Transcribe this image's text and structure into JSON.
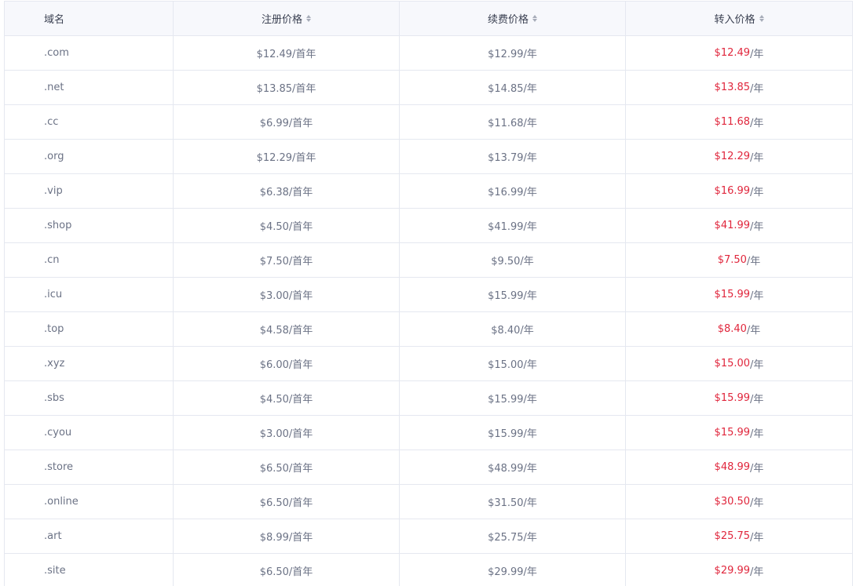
{
  "headers": {
    "domain": "域名",
    "register": "注册价格",
    "renew": "续费价格",
    "transfer": "转入价格"
  },
  "rows": [
    {
      "domain": ".com",
      "register": "$12.49/首年",
      "renew": "$12.99/年",
      "transfer_price": "$12.49",
      "transfer_unit": "/年"
    },
    {
      "domain": ".net",
      "register": "$13.85/首年",
      "renew": "$14.85/年",
      "transfer_price": "$13.85",
      "transfer_unit": "/年"
    },
    {
      "domain": ".cc",
      "register": "$6.99/首年",
      "renew": "$11.68/年",
      "transfer_price": "$11.68",
      "transfer_unit": "/年"
    },
    {
      "domain": ".org",
      "register": "$12.29/首年",
      "renew": "$13.79/年",
      "transfer_price": "$12.29",
      "transfer_unit": "/年"
    },
    {
      "domain": ".vip",
      "register": "$6.38/首年",
      "renew": "$16.99/年",
      "transfer_price": "$16.99",
      "transfer_unit": "/年"
    },
    {
      "domain": ".shop",
      "register": "$4.50/首年",
      "renew": "$41.99/年",
      "transfer_price": "$41.99",
      "transfer_unit": "/年"
    },
    {
      "domain": ".cn",
      "register": "$7.50/首年",
      "renew": "$9.50/年",
      "transfer_price": "$7.50",
      "transfer_unit": "/年"
    },
    {
      "domain": ".icu",
      "register": "$3.00/首年",
      "renew": "$15.99/年",
      "transfer_price": "$15.99",
      "transfer_unit": "/年"
    },
    {
      "domain": ".top",
      "register": "$4.58/首年",
      "renew": "$8.40/年",
      "transfer_price": "$8.40",
      "transfer_unit": "/年"
    },
    {
      "domain": ".xyz",
      "register": "$6.00/首年",
      "renew": "$15.00/年",
      "transfer_price": "$15.00",
      "transfer_unit": "/年"
    },
    {
      "domain": ".sbs",
      "register": "$4.50/首年",
      "renew": "$15.99/年",
      "transfer_price": "$15.99",
      "transfer_unit": "/年"
    },
    {
      "domain": ".cyou",
      "register": "$3.00/首年",
      "renew": "$15.99/年",
      "transfer_price": "$15.99",
      "transfer_unit": "/年"
    },
    {
      "domain": ".store",
      "register": "$6.50/首年",
      "renew": "$48.99/年",
      "transfer_price": "$48.99",
      "transfer_unit": "/年"
    },
    {
      "domain": ".online",
      "register": "$6.50/首年",
      "renew": "$31.50/年",
      "transfer_price": "$30.50",
      "transfer_unit": "/年"
    },
    {
      "domain": ".art",
      "register": "$8.99/首年",
      "renew": "$25.75/年",
      "transfer_price": "$25.75",
      "transfer_unit": "/年"
    },
    {
      "domain": ".site",
      "register": "$6.50/首年",
      "renew": "$29.99/年",
      "transfer_price": "$29.99",
      "transfer_unit": "/年"
    }
  ],
  "colors": {
    "header_bg": "#f7f8fc",
    "border": "#e5e8f0",
    "text": "#6b7285",
    "header_text": "#3b4152",
    "transfer_price": "#e0263c"
  }
}
